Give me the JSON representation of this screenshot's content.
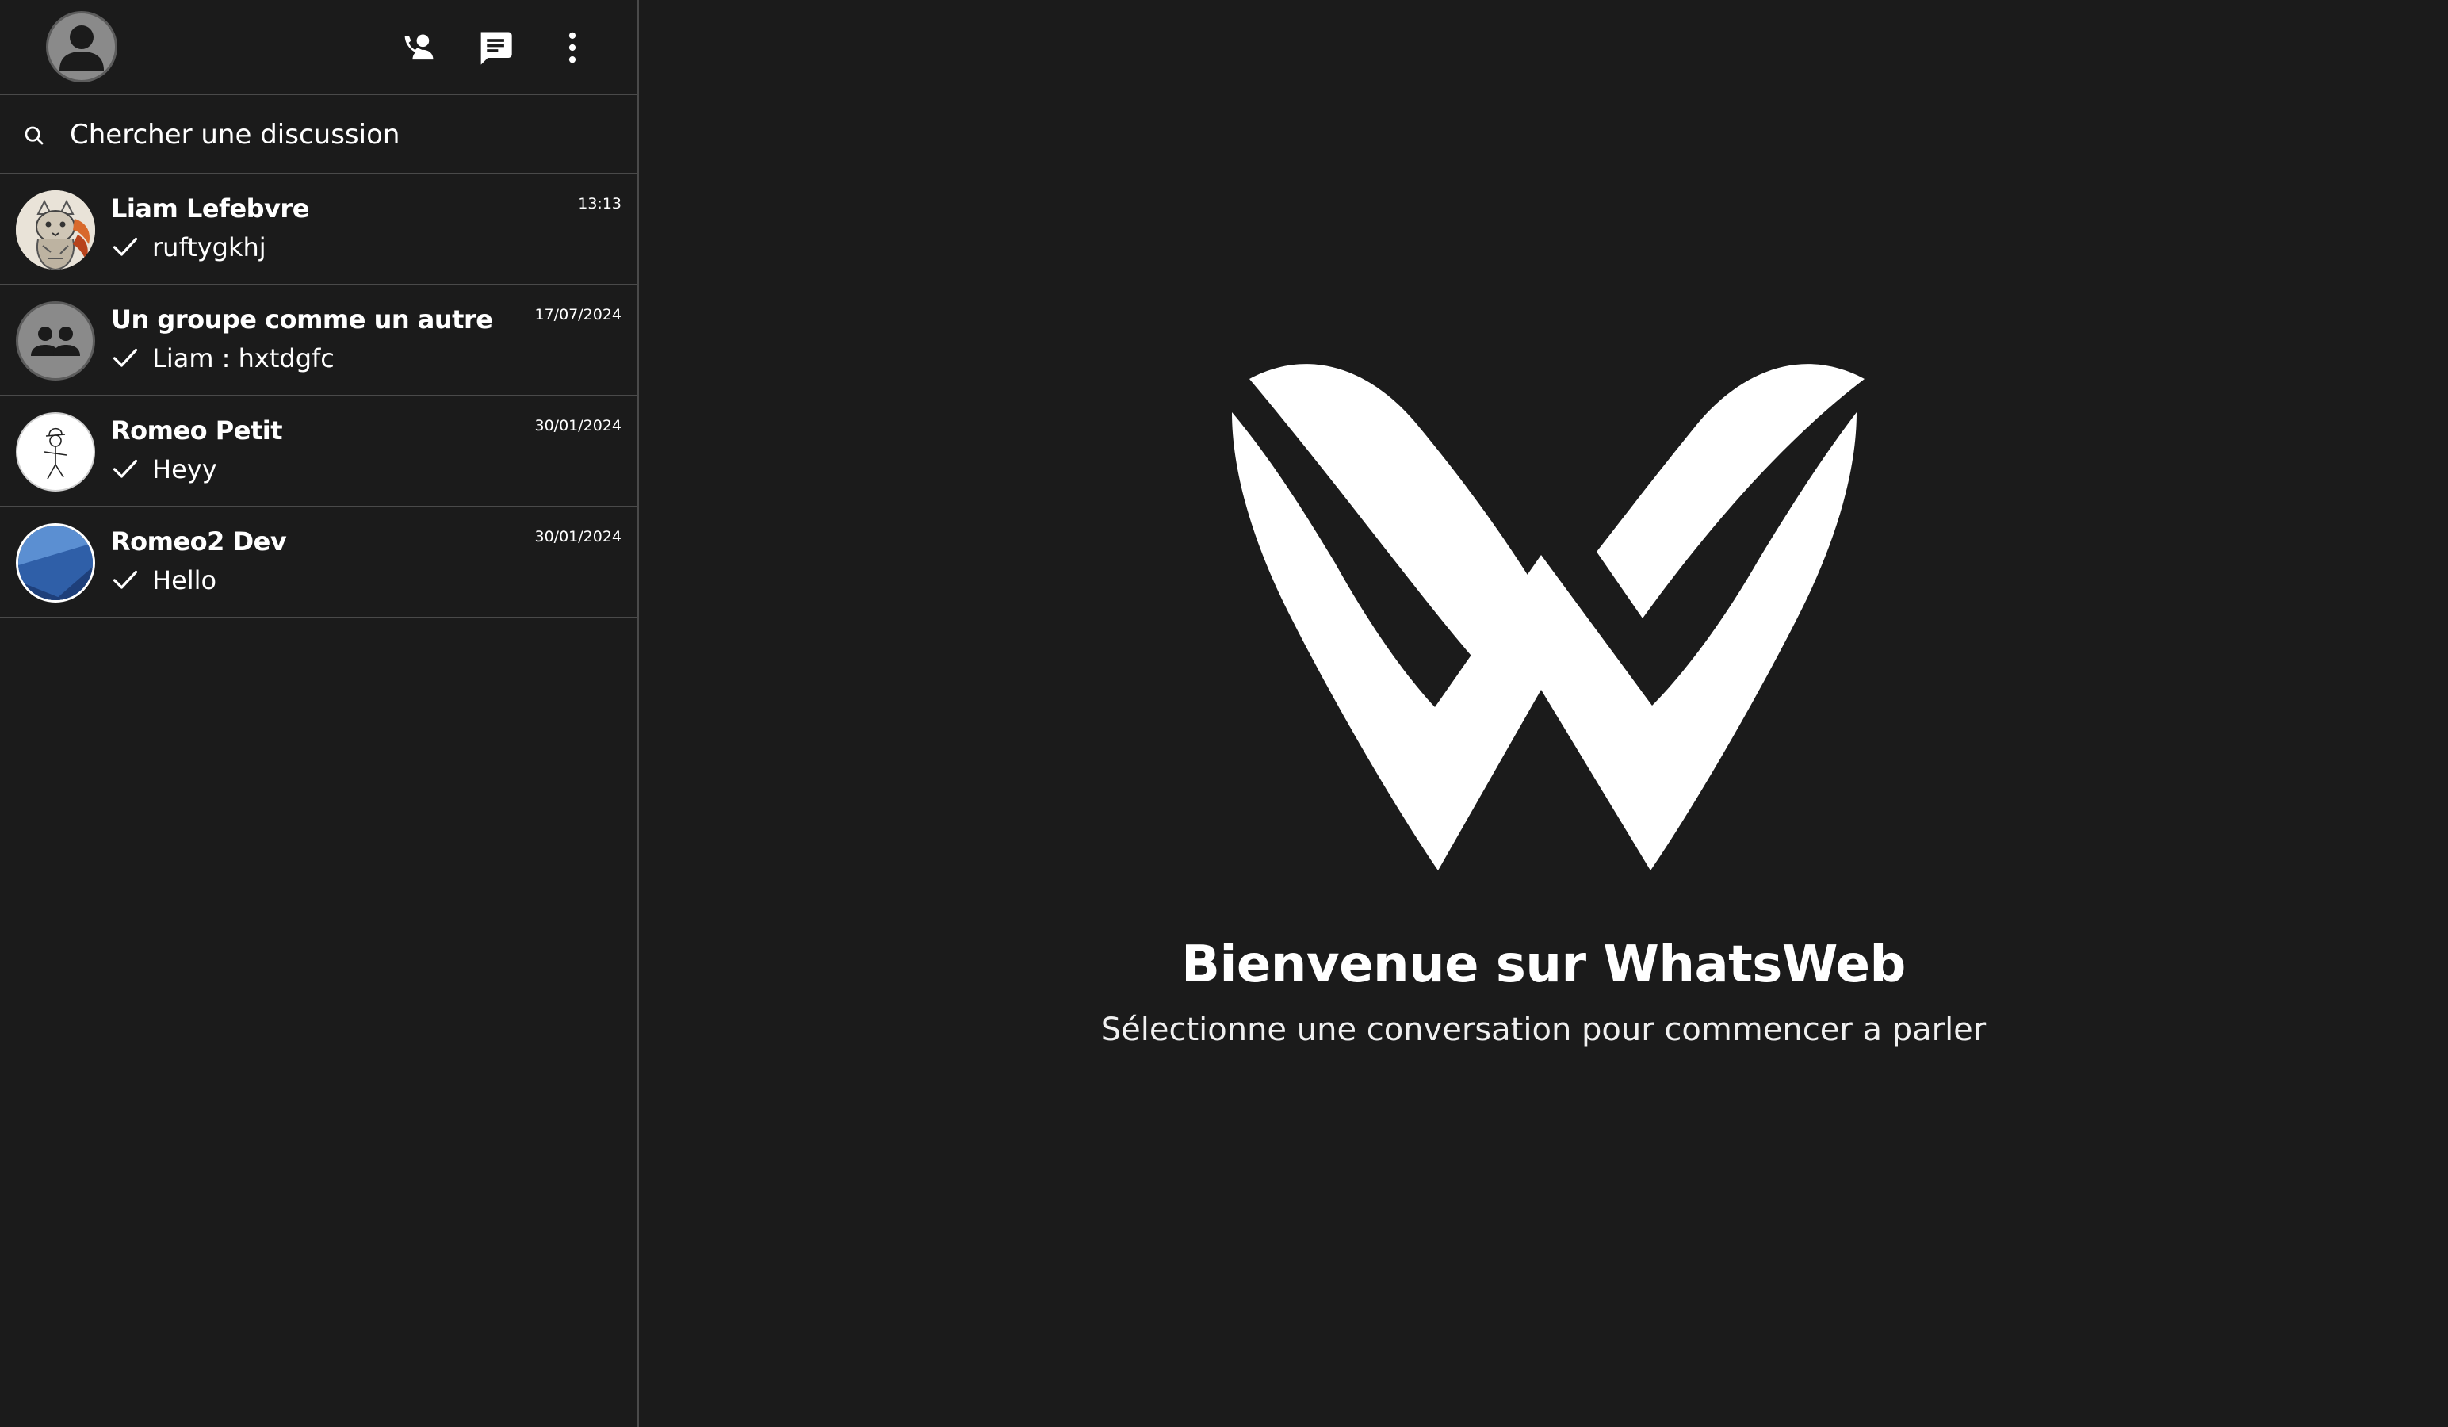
{
  "colors": {
    "background": "#1b1b1b",
    "divider": "#4a4a4a",
    "text": "#ffffff"
  },
  "header": {
    "icons": [
      "avatar-icon",
      "contact-call-icon",
      "new-chat-icon",
      "more-options-icon"
    ]
  },
  "search": {
    "placeholder": "Chercher une discussion"
  },
  "chats": [
    {
      "name": "Liam Lefebvre",
      "last_message": "ruftygkhj",
      "time": "13:13",
      "avatar": "cat-sketch-avatar"
    },
    {
      "name": "Un groupe comme un autre",
      "last_message": "Liam : hxtdgfc",
      "time": "17/07/2024",
      "avatar": "group-icon"
    },
    {
      "name": "Romeo Petit",
      "last_message": "Heyy",
      "time": "30/01/2024",
      "avatar": "stick-figure-avatar"
    },
    {
      "name": "Romeo2 Dev",
      "last_message": "Hello",
      "time": "30/01/2024",
      "avatar": "blue-gradient-avatar"
    }
  ],
  "welcome": {
    "title": "Bienvenue sur WhatsWeb",
    "subtitle": "Sélectionne une conversation pour commencer a parler",
    "logo": "whatsweb-logo"
  }
}
